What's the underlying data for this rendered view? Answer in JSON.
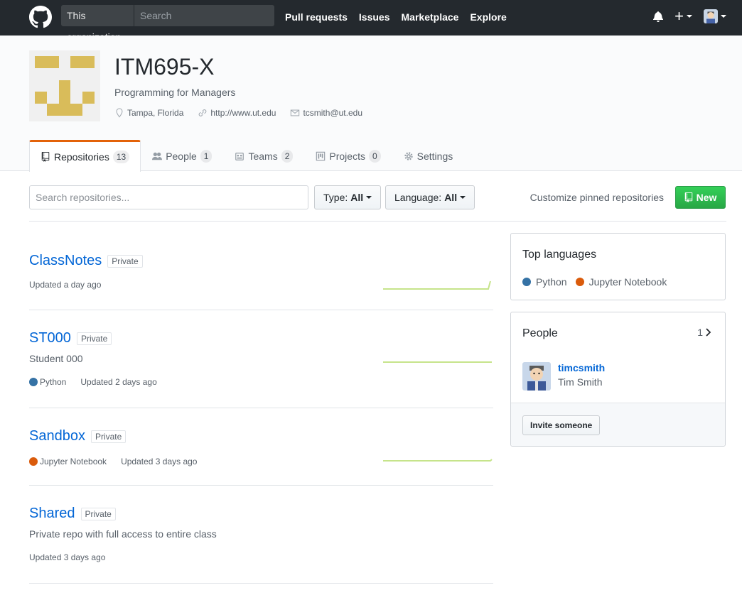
{
  "header": {
    "scope_label": "This organization",
    "search_placeholder": "Search",
    "nav": [
      "Pull requests",
      "Issues",
      "Marketplace",
      "Explore"
    ]
  },
  "org": {
    "name": "ITM695-X",
    "description": "Programming for Managers",
    "location": "Tampa, Florida",
    "website": "http://www.ut.edu",
    "email": "tcsmith@ut.edu",
    "avatar_color": "#d9bc5a"
  },
  "tabs": [
    {
      "label": "Repositories",
      "count": "13",
      "icon": "repo-icon"
    },
    {
      "label": "People",
      "count": "1",
      "icon": "people-icon"
    },
    {
      "label": "Teams",
      "count": "2",
      "icon": "teams-icon"
    },
    {
      "label": "Projects",
      "count": "0",
      "icon": "project-icon"
    },
    {
      "label": "Settings",
      "icon": "gear-icon"
    }
  ],
  "filters": {
    "search_placeholder": "Search repositories...",
    "type_label": "Type:",
    "type_value": "All",
    "language_label": "Language:",
    "language_value": "All",
    "customize_label": "Customize pinned repositories",
    "new_label": "New"
  },
  "repos": [
    {
      "name": "ClassNotes",
      "visibility": "Private",
      "description": "",
      "language": "",
      "updated": "Updated a day ago"
    },
    {
      "name": "ST000",
      "visibility": "Private",
      "description": "Student 000",
      "language": "Python",
      "updated": "Updated 2 days ago"
    },
    {
      "name": "Sandbox",
      "visibility": "Private",
      "description": "",
      "language": "Jupyter Notebook",
      "updated": "Updated 3 days ago"
    },
    {
      "name": "Shared",
      "visibility": "Private",
      "description": "Private repo with full access to entire class",
      "language": "",
      "updated": "Updated 3 days ago"
    }
  ],
  "sidebar": {
    "top_languages_title": "Top languages",
    "languages": [
      {
        "name": "Python",
        "color": "#3572A5"
      },
      {
        "name": "Jupyter Notebook",
        "color": "#DA5B0B"
      }
    ],
    "people_title": "People",
    "people_count": "1",
    "member": {
      "login": "timcsmith",
      "name": "Tim Smith"
    },
    "invite_label": "Invite someone"
  },
  "colors": {
    "accent": "#0366d6",
    "tab_highlight": "#e36209",
    "green": "#28a745",
    "python": "#3572A5",
    "jupyter": "#DA5B0B",
    "sparkline": "#c6e48b"
  }
}
